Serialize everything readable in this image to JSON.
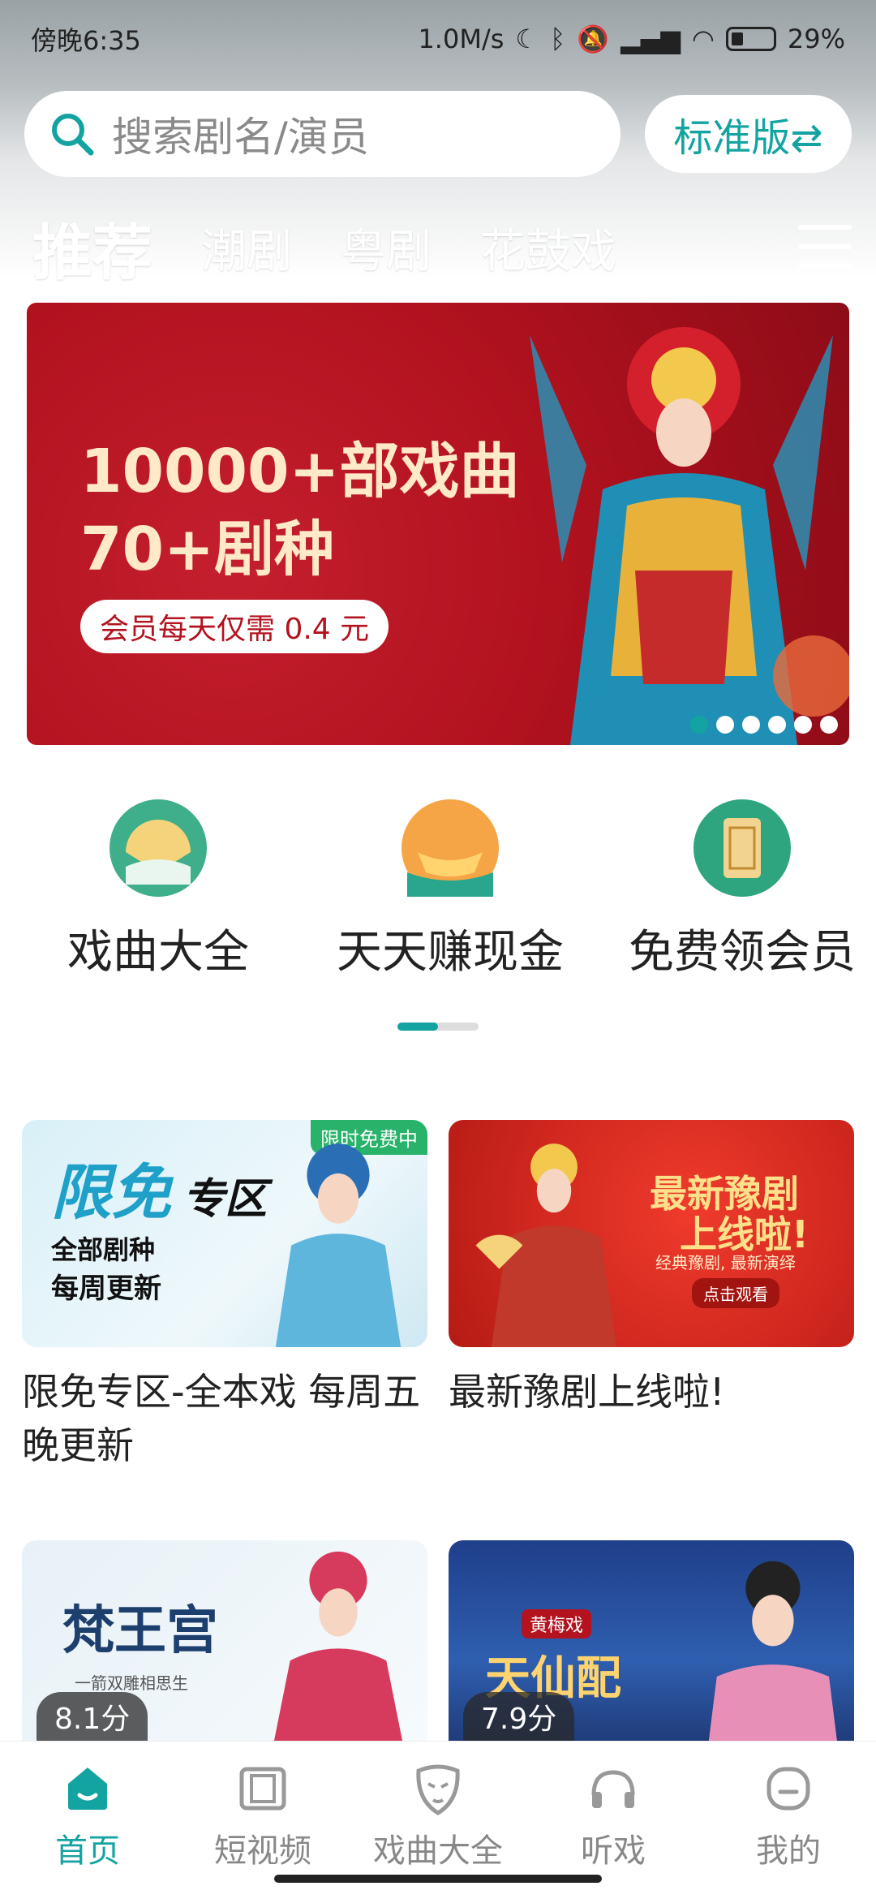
{
  "status_bar": {
    "time": "傍晚6:35",
    "net_speed": "1.0M/s",
    "battery": "29%"
  },
  "search": {
    "placeholder": "搜索剧名/演员",
    "edition_label": "标准版⇄"
  },
  "tabs": [
    {
      "label": "推荐",
      "active": true
    },
    {
      "label": "潮剧",
      "active": false
    },
    {
      "label": "粤剧",
      "active": false
    },
    {
      "label": "花鼓戏",
      "active": false
    }
  ],
  "banner": {
    "line1": "10000+部戏曲",
    "line2": "70+剧种",
    "pill": "会员每天仅需 0.4 元",
    "slides": 6,
    "active_slide": 0
  },
  "quick_entries": [
    {
      "label": "戏曲大全",
      "icon": "fan-icon"
    },
    {
      "label": "天天赚现金",
      "icon": "gold-ingot-icon"
    },
    {
      "label": "免费领会员",
      "icon": "vip-scroll-icon"
    }
  ],
  "cards": [
    {
      "title": "限免专区-全本戏 每周五晚更新",
      "img_text_big": "限免",
      "img_text_big2": "专区",
      "img_line1": "全部剧种",
      "img_line2": "每周更新",
      "img_tag": "限时免费中"
    },
    {
      "title": "最新豫剧上线啦!",
      "img_text_big": "最新豫剧",
      "img_text_big2": "上线啦!",
      "img_line1": "经典豫剧, 最新演绎",
      "img_tag": "点击观看"
    },
    {
      "title": "",
      "img_text_big": "梵王宫",
      "img_line1": "一箭双雕相思生",
      "score": "8.1分"
    },
    {
      "title": "",
      "img_text_big": "天仙配",
      "img_tag": "黄梅戏",
      "score": "7.9分"
    }
  ],
  "bottom_nav": [
    {
      "label": "首页",
      "active": true
    },
    {
      "label": "短视频",
      "active": false
    },
    {
      "label": "戏曲大全",
      "active": false
    },
    {
      "label": "听戏",
      "active": false
    },
    {
      "label": "我的",
      "active": false
    }
  ],
  "colors": {
    "accent": "#13a3a0",
    "banner_red": "#b3121f"
  }
}
